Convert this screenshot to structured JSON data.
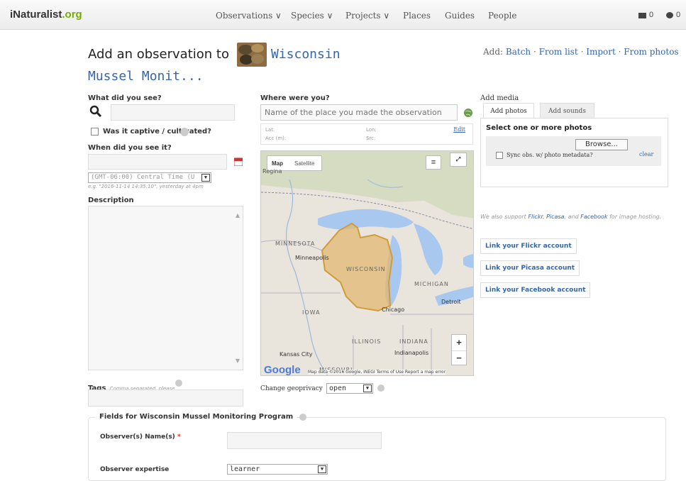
{
  "nav": {
    "logo_main": "iNaturalist",
    "logo_suffix": ".org",
    "links": [
      "Observations ∨",
      "Species ∨",
      "Projects ∨",
      "Places",
      "Guides",
      "People"
    ],
    "messages_count": "0",
    "comments_count": "0"
  },
  "heading": {
    "prefix": "Add an observation to",
    "project_line1": "Wisconsin",
    "project_line2": "Mussel Monit..."
  },
  "add_links": {
    "label": "Add:",
    "batch": "Batch",
    "from_list": "From list",
    "import": "Import",
    "from_photos": "From photos",
    "sep": " · "
  },
  "what": {
    "label": "What did you see?",
    "captive_label": "Was it captive / cultivated?"
  },
  "when": {
    "label": "When did you see it?",
    "timezone": "(GMT-06:00) Central Time (U",
    "hint": "e.g. \"2016-11-14 14:35:10\", yesterday at 4pm"
  },
  "description": {
    "label": "Description"
  },
  "tags": {
    "label": "Tags",
    "hint": "Comma separated, please"
  },
  "where": {
    "label": "Where were you?",
    "placeholder": "Name of the place you made the observation",
    "lat_label": "Lat:",
    "lon_label": "Lon:",
    "acc_label": "Acc (m):",
    "src_label": "Src:",
    "edit": "Edit"
  },
  "map": {
    "tab_map": "Map",
    "tab_satellite": "Satellite",
    "states": [
      "MINNESOTA",
      "WISCONSIN",
      "MICHIGAN",
      "IOWA",
      "ILLINOIS",
      "INDIANA",
      "MISSOURI"
    ],
    "cities": [
      "Minneapolis",
      "Chicago",
      "Detroit",
      "Kansas City",
      "Indianapolis"
    ],
    "corner_label": "Regina",
    "google": "Google",
    "attribution": "Map data ©2016 Google, INEGI   Terms of Use   Report a map error"
  },
  "geoprivacy": {
    "label": "Change geoprivacy",
    "value": "open"
  },
  "media": {
    "label": "Add media",
    "tab_photos": "Add photos",
    "tab_sounds": "Add sounds",
    "select_label": "Select one or more photos",
    "browse": "Browse...",
    "sync_label": "Sync obs. w/ photo metadata?",
    "clear": "clear",
    "support_prefix": "We also support ",
    "flickr": "Flickr",
    "picasa": "Picasa",
    "and": "and",
    "facebook": "Facebook",
    "support_suffix": " for image hosting.",
    "link_flickr": "Link your Flickr account",
    "link_picasa": "Link your Picasa account",
    "link_facebook": "Link your Facebook account"
  },
  "fields": {
    "legend": "Fields for Wisconsin Mussel Monitoring Program",
    "observer_label": "Observer(s) Name(s)",
    "required_mark": "*",
    "expertise_label": "Observer expertise",
    "expertise_value": "learner"
  }
}
